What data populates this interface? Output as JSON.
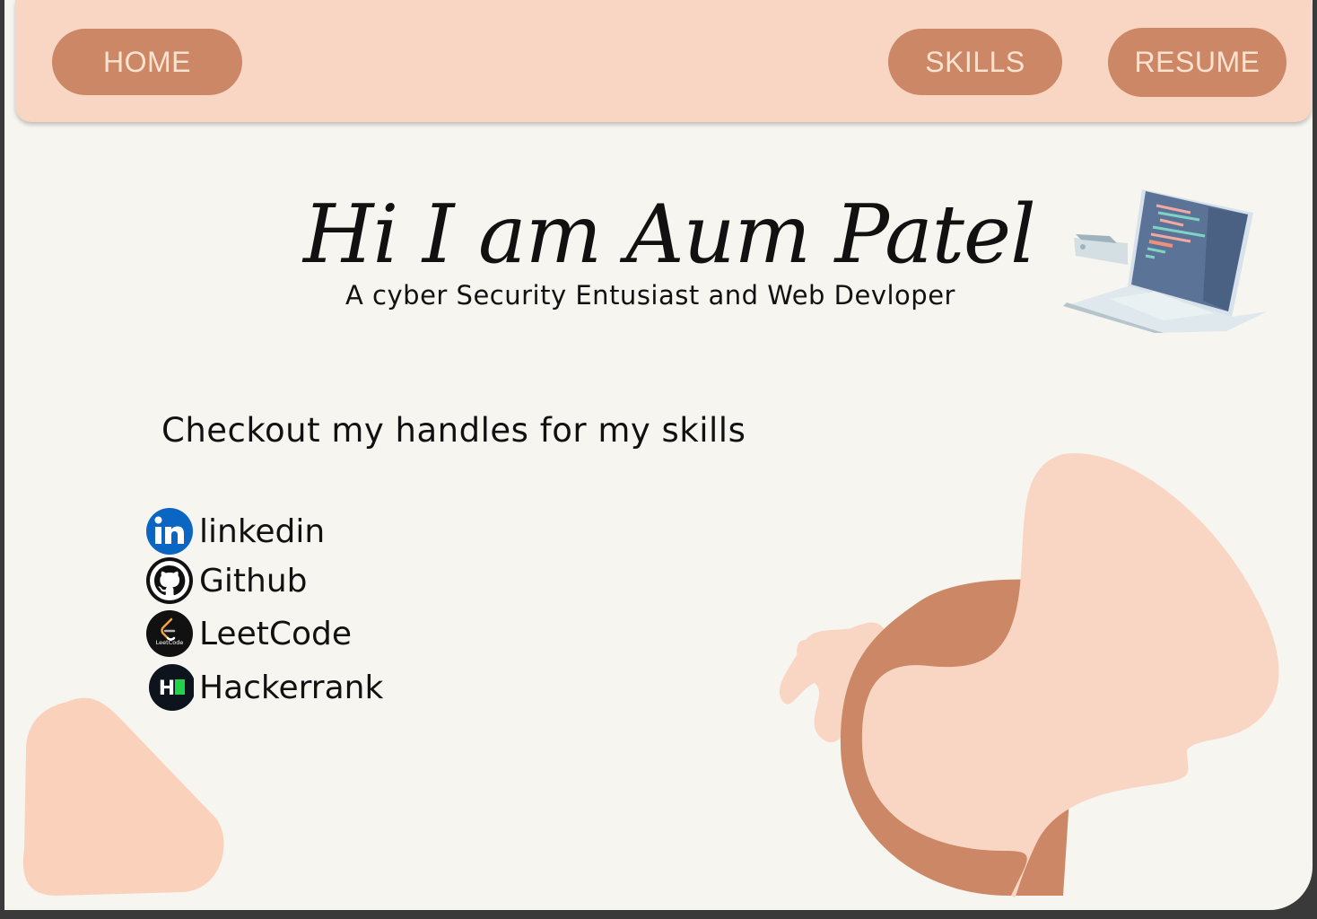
{
  "nav": {
    "home": "HOME",
    "skills": "SKILLS",
    "resume": "RESUME"
  },
  "hero": {
    "title": "Hi I am Aum Patel",
    "subtitle": "A cyber Security Entusiast and Web Devloper"
  },
  "handles": {
    "heading": "Checkout my handles for my skills",
    "items": [
      {
        "label": "linkedin",
        "icon": "linkedin-icon"
      },
      {
        "label": "Github",
        "icon": "github-icon"
      },
      {
        "label": "LeetCode",
        "icon": "leetcode-icon",
        "icon_text": "LeetCode"
      },
      {
        "label": "Hackerrank",
        "icon": "hackerrank-icon",
        "icon_text": "H"
      }
    ]
  },
  "colors": {
    "navbar": "#f9d6c3",
    "accent": "#cc8866",
    "page_background": "#f7f5f0",
    "blob_light": "#f9d6c3"
  }
}
